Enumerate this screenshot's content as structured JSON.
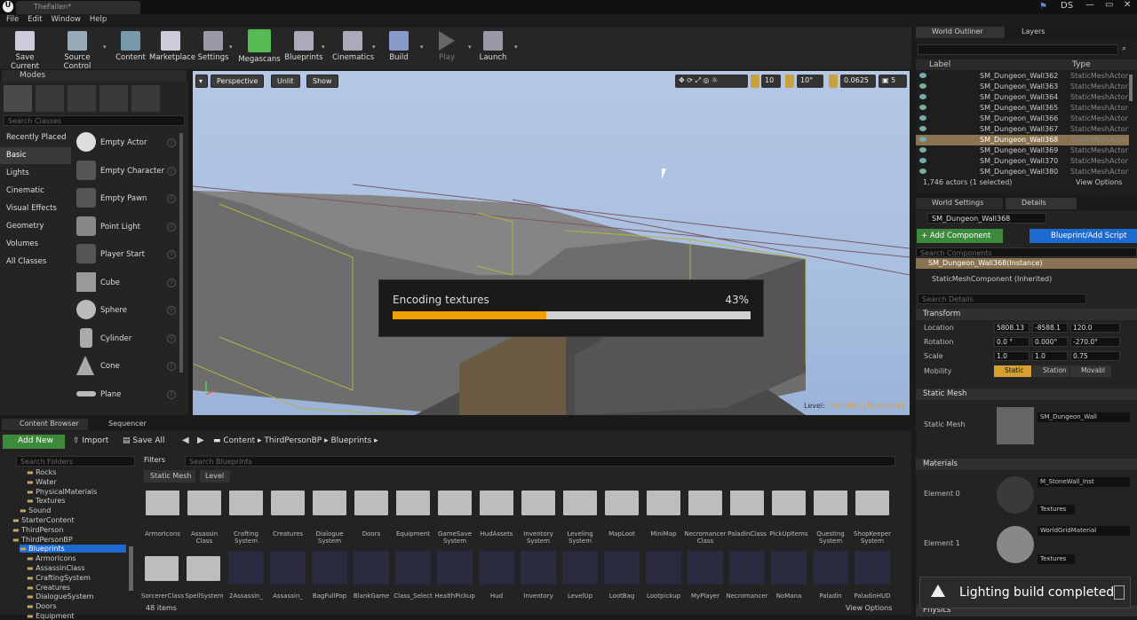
{
  "window": {
    "logo": "U",
    "doc_tab": "TheFallen*",
    "user": "DS"
  },
  "menu": [
    "File",
    "Edit",
    "Window",
    "Help"
  ],
  "toolbar": [
    "Save Current",
    "Source Control",
    "Content",
    "Marketplace",
    "Settings",
    "Megascans",
    "Blueprints",
    "Cinematics",
    "Build",
    "Play",
    "Launch"
  ],
  "modes": {
    "tab": "Modes",
    "search_placeholder": "Search Classes",
    "categories": [
      "Recently Placed",
      "Basic",
      "Lights",
      "Cinematic",
      "Visual Effects",
      "Geometry",
      "Volumes",
      "All Classes"
    ],
    "items": [
      "Empty Actor",
      "Empty Character",
      "Empty Pawn",
      "Point Light",
      "Player Start",
      "Cube",
      "Sphere",
      "Cylinder",
      "Cone",
      "Plane"
    ]
  },
  "viewport": {
    "perspective": "Perspective",
    "unlit": "Unlit",
    "show": "Show",
    "grid": "10",
    "angle": "10°",
    "scale": "0.0625",
    "speed": "5",
    "level_label": "Level:",
    "level_name": "TheFallen (Persistent)"
  },
  "progress": {
    "label": "Encoding textures",
    "percent_text": "43%",
    "value": 0.43
  },
  "outliner": {
    "tab": "World Outliner",
    "tab2": "Layers",
    "col_label": "Label",
    "col_type": "Type",
    "rows": [
      {
        "name": "SM_Dungeon_Wall362",
        "type": "StaticMeshActor"
      },
      {
        "name": "SM_Dungeon_Wall363",
        "type": "StaticMeshActor"
      },
      {
        "name": "SM_Dungeon_Wall364",
        "type": "StaticMeshActor"
      },
      {
        "name": "SM_Dungeon_Wall365",
        "type": "StaticMeshActor"
      },
      {
        "name": "SM_Dungeon_Wall366",
        "type": "StaticMeshActor"
      },
      {
        "name": "SM_Dungeon_Wall367",
        "type": "StaticMeshActor"
      },
      {
        "name": "SM_Dungeon_Wall368",
        "type": "StaticMeshActor"
      },
      {
        "name": "SM_Dungeon_Wall369",
        "type": "StaticMeshActor"
      },
      {
        "name": "SM_Dungeon_Wall370",
        "type": "StaticMeshActor"
      },
      {
        "name": "SM_Dungeon_Wall380",
        "type": "StaticMeshActor"
      }
    ],
    "selected_index": 6,
    "footer": "1,746 actors (1 selected)",
    "view_options": "View Options"
  },
  "details": {
    "tab1": "World Settings",
    "tab2": "Details",
    "name": "SM_Dungeon_Wall368",
    "add_component": "+ Add Component",
    "blueprint": "Blueprint/Add Script",
    "search_comp": "Search Components",
    "instance": "SM_Dungeon_Wall368(Instance)",
    "component": "StaticMeshComponent (Inherited)",
    "search_details": "Search Details",
    "transform": "Transform",
    "location": "Location",
    "rotation": "Rotation",
    "scale": "Scale",
    "mobility": "Mobility",
    "loc": [
      "5808.13",
      "-8588.1",
      "120.0"
    ],
    "rot": [
      "0.0 °",
      "0.000°",
      "-270.0°"
    ],
    "scl": [
      "1.0",
      "1.0",
      "0.75"
    ],
    "mob": [
      "Static",
      "Station",
      "Movabl"
    ],
    "static_mesh_sec": "Static Mesh",
    "static_mesh_prop": "Static Mesh",
    "mesh_value": "SM_Dungeon_Wall",
    "materials": "Materials",
    "el0": "Element 0",
    "el1": "Element 1",
    "mat0": "M_StoneWall_Inst",
    "mat1": "WorldGridMaterial",
    "textures": "Textures",
    "physics": "Physics"
  },
  "content": {
    "tab": "Content Browser",
    "tab2": "Sequencer",
    "add_new": "Add New",
    "import": "Import",
    "save_all": "Save All",
    "path": [
      "Content",
      "ThirdPersonBP",
      "Blueprints"
    ],
    "search_folders": "Search Folders",
    "filters": "Filters",
    "search_bp": "Search Blueprints",
    "filter_chips": [
      "Static Mesh",
      "Level"
    ],
    "tree": [
      "Rocks",
      "Water",
      "PhysicalMaterials",
      "Textures",
      "Sound",
      "StarterContent",
      "ThirdPerson",
      "ThirdPersonBP",
      "Blueprints",
      "ArmorIcons",
      "AssassinClass",
      "CraftingSystem",
      "Creatures",
      "DialogueSystem",
      "Doors",
      "Equipment"
    ],
    "row1": [
      "ArmorIcons",
      "Assassin Class",
      "Crafting System",
      "Creatures",
      "Dialogue System",
      "Doors",
      "Equipment",
      "GameSave System",
      "HudAssets",
      "Inventory System",
      "Leveling System",
      "MapLoot",
      "MiniMap",
      "Necromancer Class",
      "PaladinClass",
      "PickUpItems",
      "Questing System",
      "ShopKeeper System"
    ],
    "row2": [
      "SorcererClass",
      "SpellSystem",
      "2Assassin_",
      "Assassin_",
      "BagFullPop",
      "BlankGame",
      "Class_Select",
      "HealthPickup",
      "Hud",
      "Inventory",
      "LevelUp",
      "LootBag",
      "Lootpickup",
      "MyPlayer",
      "Necromancer",
      "NoMana",
      "Paladin",
      "PaladinHUD"
    ],
    "count": "48 items",
    "view_options": "View Options"
  },
  "toast": "Lighting build completed"
}
